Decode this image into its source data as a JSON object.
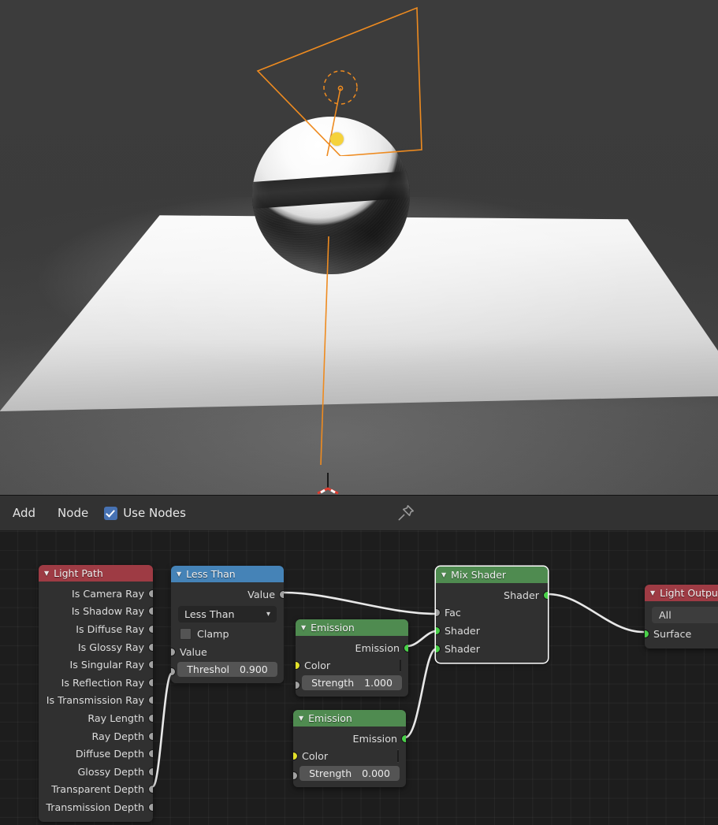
{
  "viewport": {
    "name": "3d-viewport",
    "objects": [
      "area-light-gizmo",
      "sphere",
      "floor-plane",
      "3d-cursor"
    ]
  },
  "header": {
    "menus": [
      {
        "label": "Add",
        "name": "add-menu"
      },
      {
        "label": "Node",
        "name": "node-menu"
      }
    ],
    "use_nodes": {
      "label": "Use Nodes",
      "checked": true
    },
    "pin_icon": "pin-icon"
  },
  "node_editor": {
    "nodes": [
      {
        "id": "light-path",
        "title": "Light Path",
        "header_color": "#9e3b44",
        "selected": false,
        "outputs": [
          "Is Camera Ray",
          "Is Shadow Ray",
          "Is Diffuse Ray",
          "Is Glossy Ray",
          "Is Singular Ray",
          "Is Reflection Ray",
          "Is Transmission Ray",
          "Ray Length",
          "Ray Depth",
          "Diffuse Depth",
          "Glossy Depth",
          "Transparent Depth",
          "Transmission Depth"
        ]
      },
      {
        "id": "less-than",
        "title": "Less Than",
        "header_color": "#4583b7",
        "selected": false,
        "outputs": [
          "Value"
        ],
        "operation": "Less Than",
        "clamp_label": "Clamp",
        "clamp_checked": false,
        "input_value_label": "Value",
        "threshold_label": "Threshol",
        "threshold_value": "0.900"
      },
      {
        "id": "emission-top",
        "title": "Emission",
        "header_color": "#4f8b50",
        "selected": false,
        "outputs": [
          "Emission"
        ],
        "color_label": "Color",
        "color_value": "#ffffff",
        "strength_label": "Strength",
        "strength_value": "1.000"
      },
      {
        "id": "emission-bottom",
        "title": "Emission",
        "header_color": "#4f8b50",
        "selected": false,
        "outputs": [
          "Emission"
        ],
        "color_label": "Color",
        "color_value": "#ffffff",
        "strength_label": "Strength",
        "strength_value": "0.000"
      },
      {
        "id": "mix-shader",
        "title": "Mix Shader",
        "header_color": "#4f8b50",
        "selected": true,
        "outputs": [
          "Shader"
        ],
        "inputs": [
          "Fac",
          "Shader",
          "Shader"
        ]
      },
      {
        "id": "light-output",
        "title": "Light Output",
        "header_color": "#9e3b44",
        "selected": false,
        "target": "All",
        "inputs": [
          "Surface"
        ]
      }
    ],
    "links": [
      {
        "from": "light-path.Transparent Depth",
        "to": "less-than.Value"
      },
      {
        "from": "less-than.Value",
        "to": "mix-shader.Fac"
      },
      {
        "from": "emission-top.Emission",
        "to": "mix-shader.Shader1"
      },
      {
        "from": "emission-bottom.Emission",
        "to": "mix-shader.Shader2"
      },
      {
        "from": "mix-shader.Shader",
        "to": "light-output.Surface"
      }
    ]
  }
}
